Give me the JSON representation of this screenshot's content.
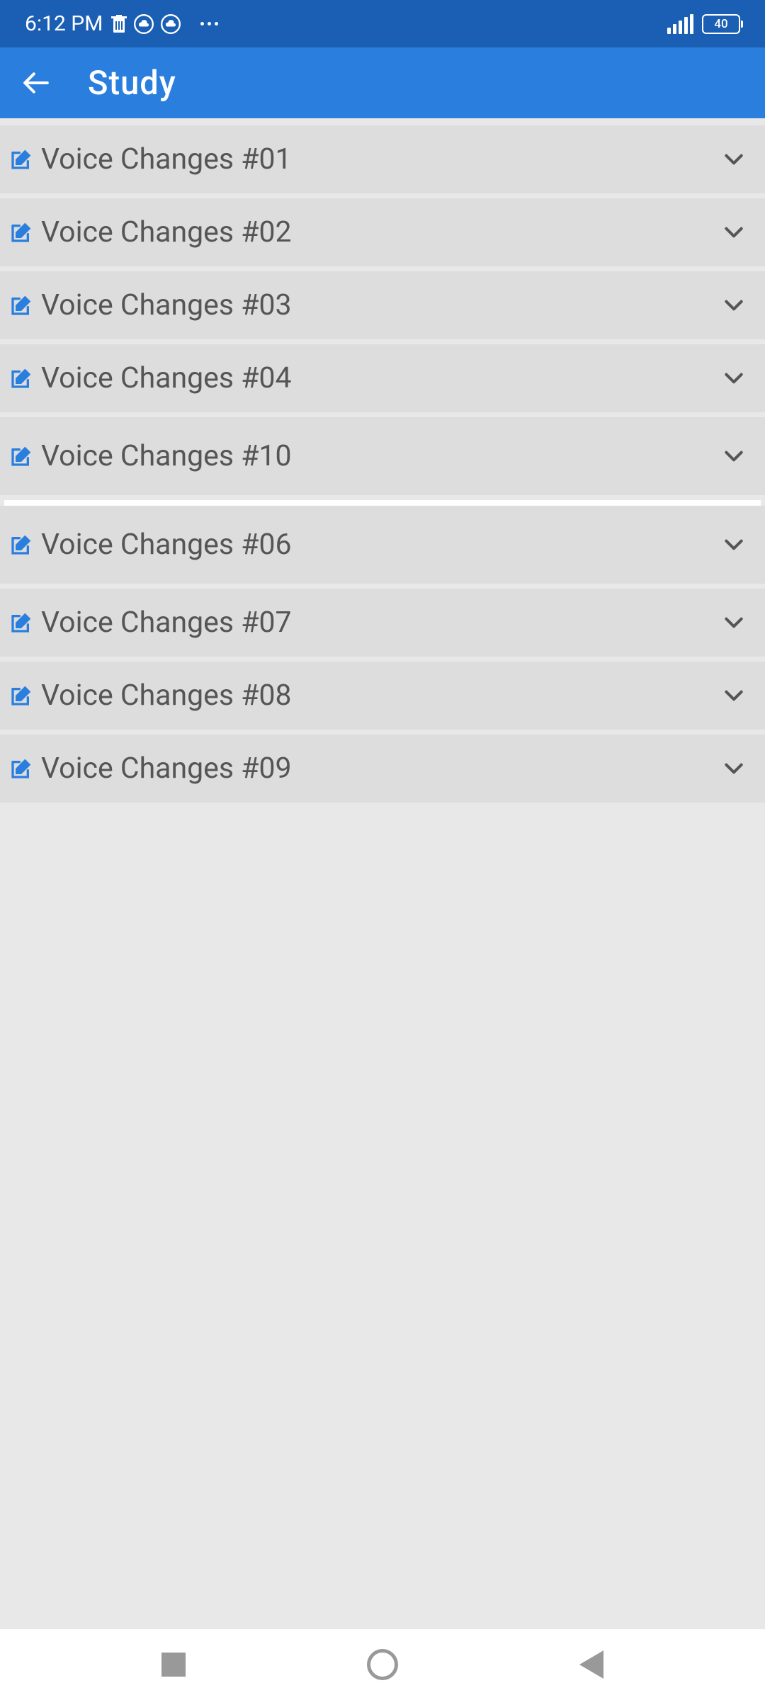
{
  "statusBar": {
    "time": "6:12 PM",
    "batteryLevel": "40"
  },
  "appBar": {
    "title": "Study"
  },
  "items": [
    {
      "label": "Voice Changes #01",
      "tall": false
    },
    {
      "label": "Voice Changes #02",
      "tall": false
    },
    {
      "label": "Voice Changes #03",
      "tall": false
    },
    {
      "label": "Voice Changes #04",
      "tall": false
    },
    {
      "label": "Voice Changes #10",
      "tall": true
    },
    {
      "label": "Voice Changes #06",
      "tall": true
    },
    {
      "label": "Voice Changes #07",
      "tall": false
    },
    {
      "label": "Voice Changes #08",
      "tall": false
    },
    {
      "label": "Voice Changes #09",
      "tall": false
    }
  ]
}
